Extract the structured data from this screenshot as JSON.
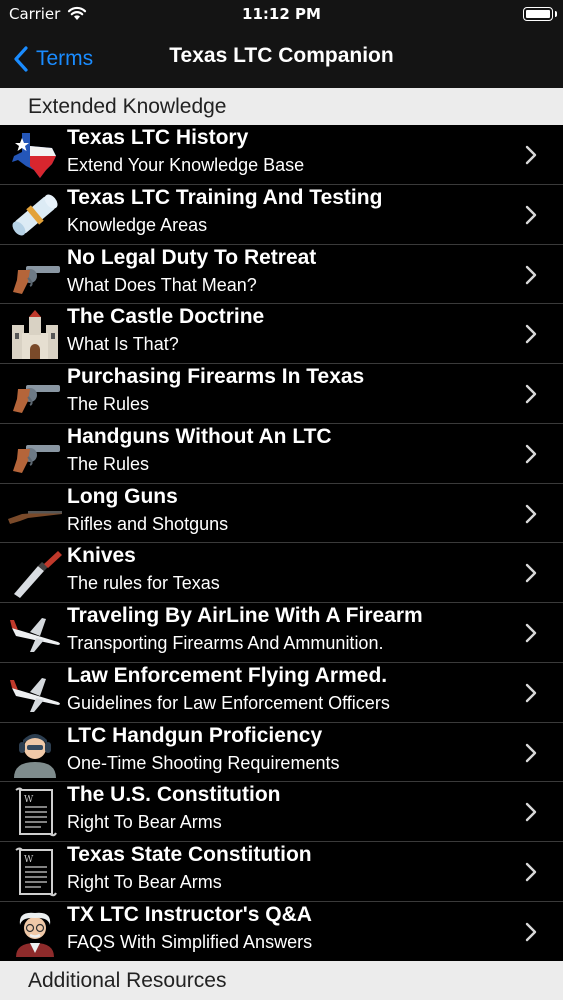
{
  "status_bar": {
    "carrier": "Carrier",
    "time": "11:12 PM"
  },
  "nav": {
    "back_label": "Terms",
    "title": "Texas LTC Companion"
  },
  "sections": [
    {
      "header": "Extended Knowledge"
    },
    {
      "header": "Additional Resources"
    }
  ],
  "items": [
    {
      "title": "Texas LTC History",
      "subtitle": "Extend Your Knowledge Base",
      "icon": "texas-flag-icon"
    },
    {
      "title": "Texas LTC Training And Testing",
      "subtitle": "Knowledge Areas",
      "icon": "diploma-icon"
    },
    {
      "title": "No Legal Duty To Retreat",
      "subtitle": "What Does That Mean?",
      "icon": "revolver-icon"
    },
    {
      "title": "The Castle Doctrine",
      "subtitle": "What Is That?",
      "icon": "castle-icon"
    },
    {
      "title": "Purchasing Firearms In Texas",
      "subtitle": "The Rules",
      "icon": "revolver-icon"
    },
    {
      "title": "Handguns Without An LTC",
      "subtitle": "The Rules",
      "icon": "revolver-icon"
    },
    {
      "title": "Long Guns",
      "subtitle": "Rifles and Shotguns",
      "icon": "rifle-icon"
    },
    {
      "title": "Knives",
      "subtitle": "The rules for Texas",
      "icon": "knife-icon"
    },
    {
      "title": "Traveling By AirLine With A Firearm",
      "subtitle": "Transporting Firearms And Ammunition.",
      "icon": "airplane-icon"
    },
    {
      "title": "Law Enforcement Flying Armed.",
      "subtitle": "Guidelines for Law Enforcement Officers",
      "icon": "airplane-icon"
    },
    {
      "title": "LTC Handgun Proficiency",
      "subtitle": "One-Time Shooting Requirements",
      "icon": "shooter-icon"
    },
    {
      "title": "The U.S. Constitution",
      "subtitle": "Right To Bear Arms",
      "icon": "scroll-document-icon"
    },
    {
      "title": "Texas State Constitution",
      "subtitle": "Right To Bear Arms",
      "icon": "scroll-document-icon"
    },
    {
      "title": "TX LTC Instructor's Q&A",
      "subtitle": "FAQS With Simplified Answers",
      "icon": "professor-icon"
    }
  ],
  "colors": {
    "accent": "#1a8cff",
    "background": "#000000",
    "section_bg": "#ececec"
  }
}
